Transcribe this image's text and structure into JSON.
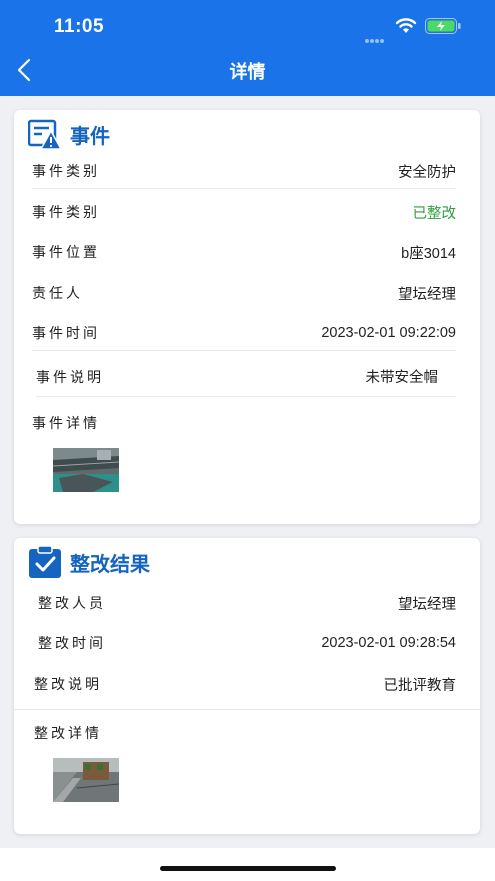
{
  "status_bar": {
    "time": "11:05"
  },
  "nav": {
    "title": "详情"
  },
  "event_card": {
    "title": "事件",
    "rows": [
      {
        "label": "事件类别",
        "value": "安全防护"
      },
      {
        "label": "事件类别",
        "value": "已整改"
      },
      {
        "label": "事件位置",
        "value": "b座3014"
      },
      {
        "label": "责任人",
        "value": "望坛经理"
      },
      {
        "label": "事件时间",
        "value": "2023-02-01 09:22:09"
      },
      {
        "label": "事件说明",
        "value": "未带安全帽"
      }
    ],
    "detail_label": "事件详情"
  },
  "rectify_card": {
    "title": "整改结果",
    "rows": [
      {
        "label": "整改人员",
        "value": "望坛经理"
      },
      {
        "label": "整改时间",
        "value": "2023-02-01 09:28:54"
      },
      {
        "label": "整改说明",
        "value": "已批评教育"
      }
    ],
    "detail_label": "整改详情"
  },
  "colors": {
    "primary": "#1a73e8",
    "status_done": "#2e9e3e",
    "battery": "#4cd964"
  }
}
